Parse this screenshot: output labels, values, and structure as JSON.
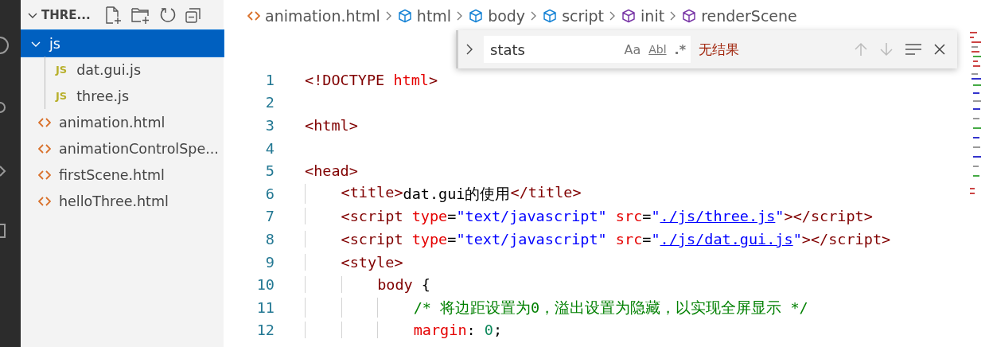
{
  "explorer": {
    "title": "THRE...",
    "expanded": true,
    "items": [
      {
        "label": "js",
        "kind": "folder",
        "expanded": true,
        "selected": true,
        "children": [
          {
            "label": "dat.gui.js",
            "kind": "js",
            "icon_label": "JS",
            "selected": false
          },
          {
            "label": "three.js",
            "kind": "js",
            "icon_label": "JS",
            "selected": false
          }
        ]
      },
      {
        "label": "animation.html",
        "kind": "html",
        "selected": false
      },
      {
        "label": "animationControlSpe...",
        "kind": "html",
        "selected": false
      },
      {
        "label": "firstScene.html",
        "kind": "html",
        "selected": false
      },
      {
        "label": "helloThree.html",
        "kind": "html",
        "selected": false
      }
    ]
  },
  "breadcrumbs": [
    {
      "label": "animation.html",
      "kind": "file"
    },
    {
      "label": "html",
      "kind": "element"
    },
    {
      "label": "body",
      "kind": "element"
    },
    {
      "label": "script",
      "kind": "element"
    },
    {
      "label": "init",
      "kind": "function"
    },
    {
      "label": "renderScene",
      "kind": "function"
    }
  ],
  "find": {
    "value": "stats",
    "options": [
      "Aa",
      "Abl",
      ".*"
    ],
    "result": "无结果"
  },
  "code_lines": [
    {
      "number": "1",
      "tokens": [
        {
          "kind": "tag",
          "text": "<!DOCTYPE "
        },
        {
          "kind": "attr",
          "text": "html"
        },
        {
          "kind": "tag",
          "text": ">"
        }
      ]
    },
    {
      "number": "2"
    },
    {
      "number": "3",
      "tokens": [
        {
          "kind": "tag",
          "text": "<html>"
        }
      ]
    },
    {
      "number": "4"
    },
    {
      "number": "5",
      "tokens": [
        {
          "kind": "tag",
          "text": "<head>"
        }
      ]
    },
    {
      "number": "6",
      "tokens": [
        {
          "kind": "tag",
          "text": "    <title>"
        },
        {
          "kind": "text",
          "text": "dat.gui的使用"
        },
        {
          "kind": "tag",
          "text": "</title>"
        }
      ]
    },
    {
      "number": "7",
      "tokens": [
        {
          "kind": "tag",
          "text": "    <script "
        },
        {
          "kind": "attr",
          "text": "type"
        },
        {
          "kind": "text",
          "text": "="
        },
        {
          "kind": "string",
          "text": "\"text/javascript\" "
        },
        {
          "kind": "attr",
          "text": "src"
        },
        {
          "kind": "text",
          "text": "="
        },
        {
          "kind": "string",
          "text": "\""
        },
        {
          "kind": "link",
          "text": "./js/three.js"
        },
        {
          "kind": "string",
          "text": "\""
        },
        {
          "kind": "tag",
          "text": "></script>"
        }
      ]
    },
    {
      "number": "8",
      "tokens": [
        {
          "kind": "tag",
          "text": "    <script "
        },
        {
          "kind": "attr",
          "text": "type"
        },
        {
          "kind": "text",
          "text": "="
        },
        {
          "kind": "string",
          "text": "\"text/javascript\" "
        },
        {
          "kind": "attr",
          "text": "src"
        },
        {
          "kind": "text",
          "text": "="
        },
        {
          "kind": "string",
          "text": "\""
        },
        {
          "kind": "link",
          "text": "./js/dat.gui.js"
        },
        {
          "kind": "string",
          "text": "\""
        },
        {
          "kind": "tag",
          "text": "></script>"
        }
      ]
    },
    {
      "number": "9",
      "tokens": [
        {
          "kind": "tag",
          "text": "    <style>"
        }
      ]
    },
    {
      "number": "10",
      "tokens": [
        {
          "kind": "selector",
          "text": "        body "
        },
        {
          "kind": "text",
          "text": "{"
        }
      ]
    },
    {
      "number": "11",
      "tokens": [
        {
          "kind": "comment",
          "text": "            /* 将边距设置为0，溢出设置为隐藏，以实现全屏显示 */"
        }
      ]
    },
    {
      "number": "12",
      "tokens": [
        {
          "kind": "attr",
          "text": "            margin"
        },
        {
          "kind": "text",
          "text": ": "
        },
        {
          "kind": "number",
          "text": "0"
        },
        {
          "kind": "text",
          "text": ";"
        }
      ]
    }
  ]
}
